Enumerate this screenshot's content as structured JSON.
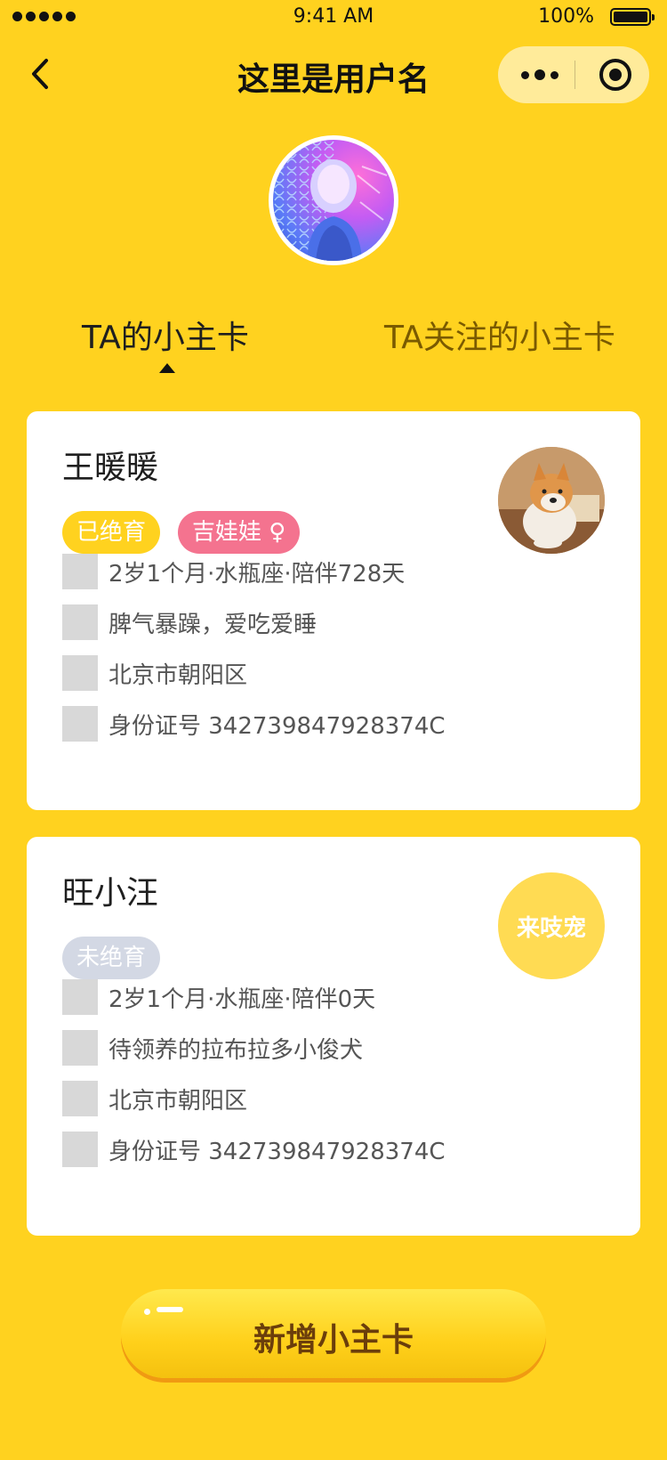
{
  "status_bar": {
    "time": "9:41 AM",
    "battery": "100%"
  },
  "nav": {
    "title": "这里是用户名"
  },
  "tabs": [
    {
      "label": "TA的小主卡",
      "active": true
    },
    {
      "label": "TA关注的小主卡",
      "active": false
    }
  ],
  "cards": [
    {
      "name": "王暖暖",
      "tags": [
        {
          "label": "已绝育",
          "color": "#FFD21F"
        },
        {
          "label": "吉娃娃 ♀",
          "color": "#F4738F"
        }
      ],
      "info": [
        "2岁1个月·水瓶座·陪伴728天",
        "脾气暴躁，爱吃爱睡",
        "北京市朝阳区",
        "身份证号  342739847928374C"
      ],
      "photo": "shiba-dog-photo"
    },
    {
      "name": "旺小汪",
      "tags": [
        {
          "label": "未绝育",
          "color": "#D3D8E4"
        }
      ],
      "info": [
        "2岁1个月·水瓶座·陪伴0天",
        "待领养的拉布拉多小俊犬",
        "北京市朝阳区",
        "身份证号  342739847928374C"
      ],
      "action": "来吱宠"
    }
  ],
  "add_button": {
    "label": "新增小主卡"
  },
  "colors": {
    "background": "#FFD21F",
    "accent_text": "#7A5A00",
    "button_text": "#6B3E0B"
  }
}
